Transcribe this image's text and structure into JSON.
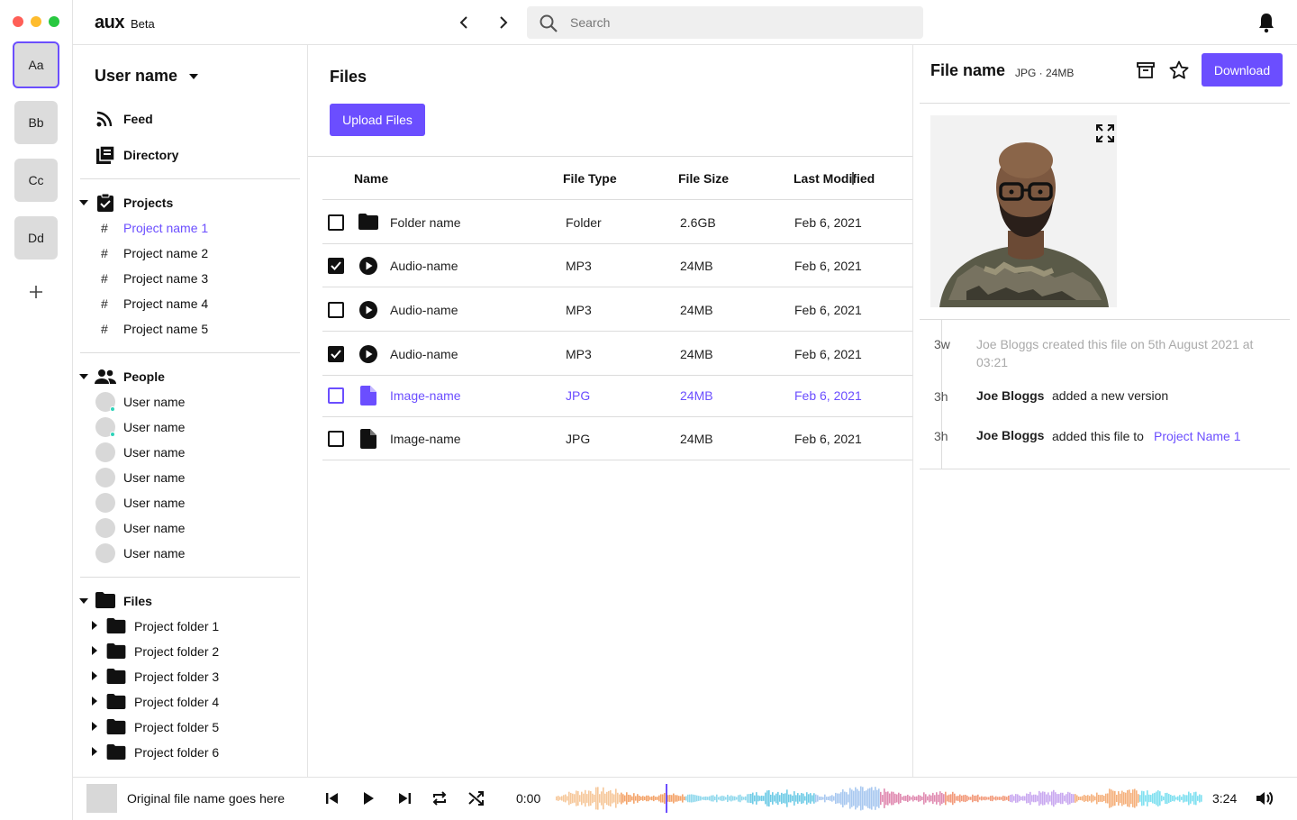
{
  "window": {
    "traffic_lights": [
      "#ff5f57",
      "#febc2e",
      "#28c840"
    ]
  },
  "workspaces": [
    "Aa",
    "Bb",
    "Cc",
    "Dd"
  ],
  "app": {
    "logo": "aux",
    "badge": "Beta"
  },
  "search": {
    "placeholder": "Search"
  },
  "sidebar": {
    "user_name": "User name",
    "nav": [
      {
        "label": "Feed",
        "icon": "rss-icon"
      },
      {
        "label": "Directory",
        "icon": "directory-icon"
      }
    ],
    "projects_label": "Projects",
    "projects": [
      "Project name 1",
      "Project name 2",
      "Project name 3",
      "Project name 4",
      "Project name 5"
    ],
    "people_label": "People",
    "people": [
      "User name",
      "User name",
      "User name",
      "User name",
      "User name",
      "User name",
      "User name"
    ],
    "files_label": "Files",
    "folders": [
      "Project folder 1",
      "Project folder 2",
      "Project folder 3",
      "Project folder 4",
      "Project folder 5",
      "Project folder 6"
    ]
  },
  "main": {
    "title": "Files",
    "upload_label": "Upload Files",
    "columns": [
      "Name",
      "File Type",
      "File Size",
      "Last Modified"
    ],
    "rows": [
      {
        "name": "Folder name",
        "type": "Folder",
        "size": "2.6GB",
        "modified": "Feb 6, 2021",
        "icon": "folder-icon",
        "checked": false,
        "selected": false
      },
      {
        "name": "Audio-name",
        "type": "MP3",
        "size": "24MB",
        "modified": "Feb 6, 2021",
        "icon": "play-circle-icon",
        "checked": true,
        "selected": false
      },
      {
        "name": "Audio-name",
        "type": "MP3",
        "size": "24MB",
        "modified": "Feb 6, 2021",
        "icon": "play-circle-icon",
        "checked": false,
        "selected": false
      },
      {
        "name": "Audio-name",
        "type": "MP3",
        "size": "24MB",
        "modified": "Feb 6, 2021",
        "icon": "play-circle-icon",
        "checked": true,
        "selected": false
      },
      {
        "name": "Image-name",
        "type": "JPG",
        "size": "24MB",
        "modified": "Feb 6, 2021",
        "icon": "file-icon",
        "checked": false,
        "selected": true
      },
      {
        "name": "Image-name",
        "type": "JPG",
        "size": "24MB",
        "modified": "Feb 6, 2021",
        "icon": "file-icon",
        "checked": false,
        "selected": false
      }
    ]
  },
  "detail": {
    "file_name": "File name",
    "meta": "JPG · 24MB",
    "download_label": "Download",
    "activity": [
      {
        "time": "3w",
        "line1": "Joe Bloggs created this file on 5th August 2021 at",
        "line2": "03:21"
      },
      {
        "time": "3h",
        "actor": "Joe Bloggs",
        "text": "added a new version"
      },
      {
        "time": "3h",
        "actor": "Joe Bloggs",
        "text": "added this file to",
        "link": "Project Name 1"
      }
    ]
  },
  "player": {
    "file_name": "Original file name goes here",
    "current_time": "0:00",
    "duration": "3:24",
    "progress": 0.17
  },
  "colors": {
    "accent": "#6b4eff",
    "online": "#2fd3b9"
  }
}
